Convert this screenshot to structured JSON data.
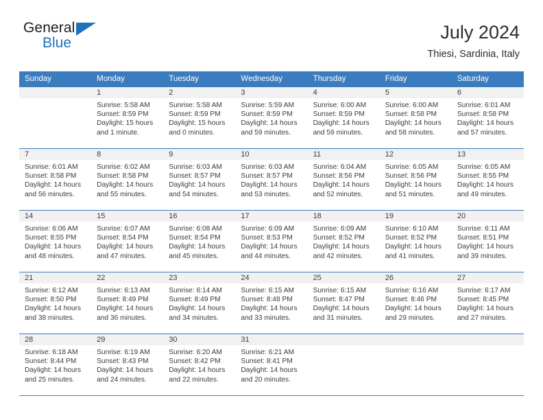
{
  "brand": {
    "name_top": "General",
    "name_bottom": "Blue",
    "triangle_color": "#1c72bd"
  },
  "header": {
    "month_title": "July 2024",
    "location": "Thiesi, Sardinia, Italy"
  },
  "theme": {
    "header_blue": "#3a7cbe",
    "daynum_band": "#f1f1f1",
    "text": "#3a3a3a"
  },
  "weekday_headers": [
    "Sunday",
    "Monday",
    "Tuesday",
    "Wednesday",
    "Thursday",
    "Friday",
    "Saturday"
  ],
  "weeks": [
    [
      {
        "day": "",
        "sunrise": "",
        "sunset": "",
        "daylight_line1": "",
        "daylight_line2": ""
      },
      {
        "day": "1",
        "sunrise": "Sunrise: 5:58 AM",
        "sunset": "Sunset: 8:59 PM",
        "daylight_line1": "Daylight: 15 hours",
        "daylight_line2": "and 1 minute."
      },
      {
        "day": "2",
        "sunrise": "Sunrise: 5:58 AM",
        "sunset": "Sunset: 8:59 PM",
        "daylight_line1": "Daylight: 15 hours",
        "daylight_line2": "and 0 minutes."
      },
      {
        "day": "3",
        "sunrise": "Sunrise: 5:59 AM",
        "sunset": "Sunset: 8:59 PM",
        "daylight_line1": "Daylight: 14 hours",
        "daylight_line2": "and 59 minutes."
      },
      {
        "day": "4",
        "sunrise": "Sunrise: 6:00 AM",
        "sunset": "Sunset: 8:59 PM",
        "daylight_line1": "Daylight: 14 hours",
        "daylight_line2": "and 59 minutes."
      },
      {
        "day": "5",
        "sunrise": "Sunrise: 6:00 AM",
        "sunset": "Sunset: 8:58 PM",
        "daylight_line1": "Daylight: 14 hours",
        "daylight_line2": "and 58 minutes."
      },
      {
        "day": "6",
        "sunrise": "Sunrise: 6:01 AM",
        "sunset": "Sunset: 8:58 PM",
        "daylight_line1": "Daylight: 14 hours",
        "daylight_line2": "and 57 minutes."
      }
    ],
    [
      {
        "day": "7",
        "sunrise": "Sunrise: 6:01 AM",
        "sunset": "Sunset: 8:58 PM",
        "daylight_line1": "Daylight: 14 hours",
        "daylight_line2": "and 56 minutes."
      },
      {
        "day": "8",
        "sunrise": "Sunrise: 6:02 AM",
        "sunset": "Sunset: 8:58 PM",
        "daylight_line1": "Daylight: 14 hours",
        "daylight_line2": "and 55 minutes."
      },
      {
        "day": "9",
        "sunrise": "Sunrise: 6:03 AM",
        "sunset": "Sunset: 8:57 PM",
        "daylight_line1": "Daylight: 14 hours",
        "daylight_line2": "and 54 minutes."
      },
      {
        "day": "10",
        "sunrise": "Sunrise: 6:03 AM",
        "sunset": "Sunset: 8:57 PM",
        "daylight_line1": "Daylight: 14 hours",
        "daylight_line2": "and 53 minutes."
      },
      {
        "day": "11",
        "sunrise": "Sunrise: 6:04 AM",
        "sunset": "Sunset: 8:56 PM",
        "daylight_line1": "Daylight: 14 hours",
        "daylight_line2": "and 52 minutes."
      },
      {
        "day": "12",
        "sunrise": "Sunrise: 6:05 AM",
        "sunset": "Sunset: 8:56 PM",
        "daylight_line1": "Daylight: 14 hours",
        "daylight_line2": "and 51 minutes."
      },
      {
        "day": "13",
        "sunrise": "Sunrise: 6:05 AM",
        "sunset": "Sunset: 8:55 PM",
        "daylight_line1": "Daylight: 14 hours",
        "daylight_line2": "and 49 minutes."
      }
    ],
    [
      {
        "day": "14",
        "sunrise": "Sunrise: 6:06 AM",
        "sunset": "Sunset: 8:55 PM",
        "daylight_line1": "Daylight: 14 hours",
        "daylight_line2": "and 48 minutes."
      },
      {
        "day": "15",
        "sunrise": "Sunrise: 6:07 AM",
        "sunset": "Sunset: 8:54 PM",
        "daylight_line1": "Daylight: 14 hours",
        "daylight_line2": "and 47 minutes."
      },
      {
        "day": "16",
        "sunrise": "Sunrise: 6:08 AM",
        "sunset": "Sunset: 8:54 PM",
        "daylight_line1": "Daylight: 14 hours",
        "daylight_line2": "and 45 minutes."
      },
      {
        "day": "17",
        "sunrise": "Sunrise: 6:09 AM",
        "sunset": "Sunset: 8:53 PM",
        "daylight_line1": "Daylight: 14 hours",
        "daylight_line2": "and 44 minutes."
      },
      {
        "day": "18",
        "sunrise": "Sunrise: 6:09 AM",
        "sunset": "Sunset: 8:52 PM",
        "daylight_line1": "Daylight: 14 hours",
        "daylight_line2": "and 42 minutes."
      },
      {
        "day": "19",
        "sunrise": "Sunrise: 6:10 AM",
        "sunset": "Sunset: 8:52 PM",
        "daylight_line1": "Daylight: 14 hours",
        "daylight_line2": "and 41 minutes."
      },
      {
        "day": "20",
        "sunrise": "Sunrise: 6:11 AM",
        "sunset": "Sunset: 8:51 PM",
        "daylight_line1": "Daylight: 14 hours",
        "daylight_line2": "and 39 minutes."
      }
    ],
    [
      {
        "day": "21",
        "sunrise": "Sunrise: 6:12 AM",
        "sunset": "Sunset: 8:50 PM",
        "daylight_line1": "Daylight: 14 hours",
        "daylight_line2": "and 38 minutes."
      },
      {
        "day": "22",
        "sunrise": "Sunrise: 6:13 AM",
        "sunset": "Sunset: 8:49 PM",
        "daylight_line1": "Daylight: 14 hours",
        "daylight_line2": "and 36 minutes."
      },
      {
        "day": "23",
        "sunrise": "Sunrise: 6:14 AM",
        "sunset": "Sunset: 8:49 PM",
        "daylight_line1": "Daylight: 14 hours",
        "daylight_line2": "and 34 minutes."
      },
      {
        "day": "24",
        "sunrise": "Sunrise: 6:15 AM",
        "sunset": "Sunset: 8:48 PM",
        "daylight_line1": "Daylight: 14 hours",
        "daylight_line2": "and 33 minutes."
      },
      {
        "day": "25",
        "sunrise": "Sunrise: 6:15 AM",
        "sunset": "Sunset: 8:47 PM",
        "daylight_line1": "Daylight: 14 hours",
        "daylight_line2": "and 31 minutes."
      },
      {
        "day": "26",
        "sunrise": "Sunrise: 6:16 AM",
        "sunset": "Sunset: 8:46 PM",
        "daylight_line1": "Daylight: 14 hours",
        "daylight_line2": "and 29 minutes."
      },
      {
        "day": "27",
        "sunrise": "Sunrise: 6:17 AM",
        "sunset": "Sunset: 8:45 PM",
        "daylight_line1": "Daylight: 14 hours",
        "daylight_line2": "and 27 minutes."
      }
    ],
    [
      {
        "day": "28",
        "sunrise": "Sunrise: 6:18 AM",
        "sunset": "Sunset: 8:44 PM",
        "daylight_line1": "Daylight: 14 hours",
        "daylight_line2": "and 25 minutes."
      },
      {
        "day": "29",
        "sunrise": "Sunrise: 6:19 AM",
        "sunset": "Sunset: 8:43 PM",
        "daylight_line1": "Daylight: 14 hours",
        "daylight_line2": "and 24 minutes."
      },
      {
        "day": "30",
        "sunrise": "Sunrise: 6:20 AM",
        "sunset": "Sunset: 8:42 PM",
        "daylight_line1": "Daylight: 14 hours",
        "daylight_line2": "and 22 minutes."
      },
      {
        "day": "31",
        "sunrise": "Sunrise: 6:21 AM",
        "sunset": "Sunset: 8:41 PM",
        "daylight_line1": "Daylight: 14 hours",
        "daylight_line2": "and 20 minutes."
      },
      {
        "day": "",
        "sunrise": "",
        "sunset": "",
        "daylight_line1": "",
        "daylight_line2": ""
      },
      {
        "day": "",
        "sunrise": "",
        "sunset": "",
        "daylight_line1": "",
        "daylight_line2": ""
      },
      {
        "day": "",
        "sunrise": "",
        "sunset": "",
        "daylight_line1": "",
        "daylight_line2": ""
      }
    ]
  ]
}
